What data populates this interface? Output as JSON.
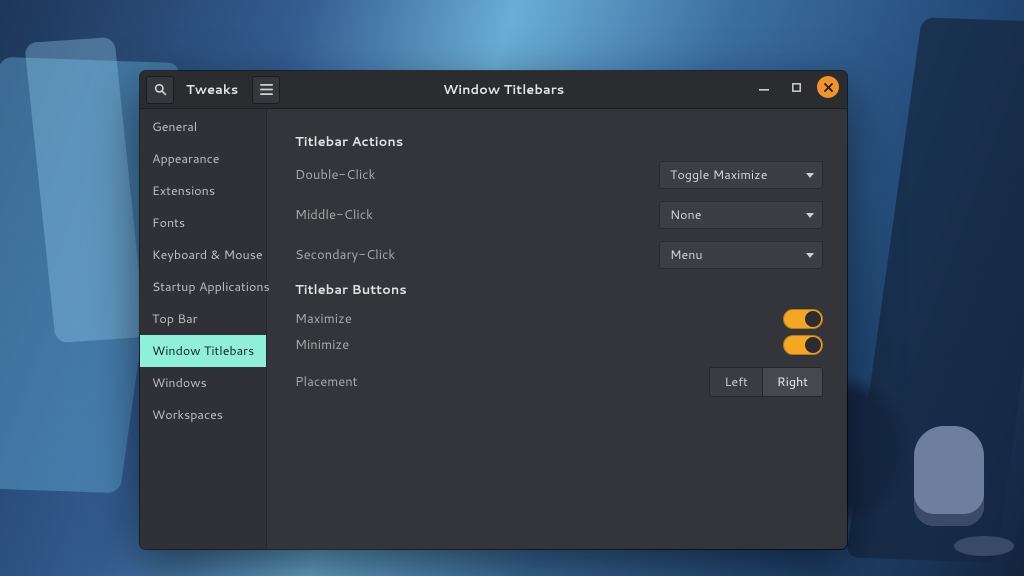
{
  "app": {
    "name": "Tweaks"
  },
  "page_title": "Window Titlebars",
  "window_controls": {
    "minimize_icon": "minimize-icon",
    "maximize_icon": "maximize-restore-icon",
    "close_icon": "close-icon"
  },
  "sidebar": {
    "items": [
      {
        "label": "General",
        "active": false
      },
      {
        "label": "Appearance",
        "active": false
      },
      {
        "label": "Extensions",
        "active": false
      },
      {
        "label": "Fonts",
        "active": false
      },
      {
        "label": "Keyboard & Mouse",
        "active": false
      },
      {
        "label": "Startup Applications",
        "active": false
      },
      {
        "label": "Top Bar",
        "active": false
      },
      {
        "label": "Window Titlebars",
        "active": true
      },
      {
        "label": "Windows",
        "active": false
      },
      {
        "label": "Workspaces",
        "active": false
      }
    ]
  },
  "sections": {
    "actions": {
      "title": "Titlebar Actions",
      "rows": [
        {
          "label": "Double-Click",
          "value": "Toggle Maximize"
        },
        {
          "label": "Middle-Click",
          "value": "None"
        },
        {
          "label": "Secondary-Click",
          "value": "Menu"
        }
      ]
    },
    "buttons": {
      "title": "Titlebar Buttons",
      "maximize": {
        "label": "Maximize",
        "on": true
      },
      "minimize": {
        "label": "Minimize",
        "on": true
      },
      "placement": {
        "label": "Placement",
        "options": [
          "Left",
          "Right"
        ],
        "selected": "Right"
      }
    }
  },
  "colors": {
    "accent": "#f5a623",
    "sidebar_active": "#8ef0db",
    "window_bg": "#33353a"
  }
}
